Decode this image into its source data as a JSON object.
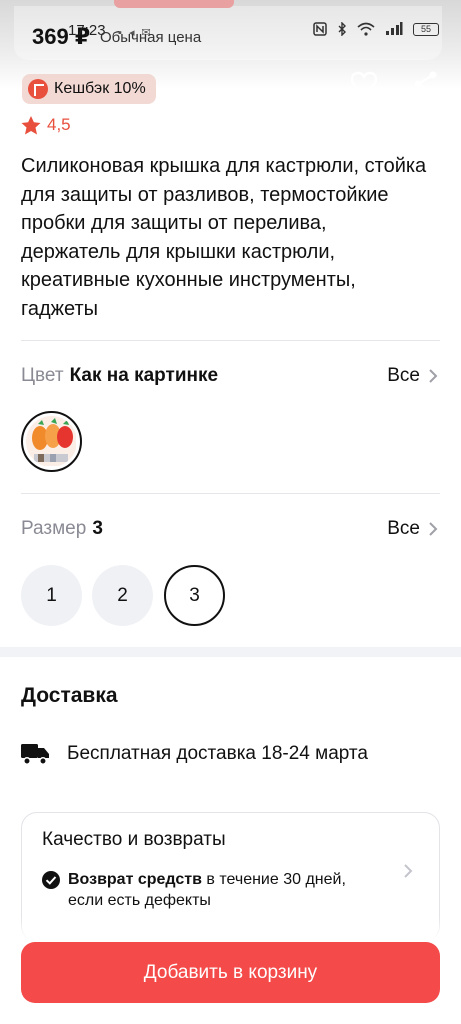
{
  "status_bar": {
    "time": "17:23",
    "battery": "55"
  },
  "header": {
    "price": "369 ₽",
    "price_note": "Обычная цена",
    "cashback": "Кешбэк 10%"
  },
  "product": {
    "rating": "4,5",
    "title": "Силиконовая крышка для кастрюли, стойка для защиты от разливов, термостойкие пробки для защиты от перелива, держатель для крышки кастрюли, креативные кухонные инструменты, гаджеты"
  },
  "color_option": {
    "label": "Цвет",
    "value": "Как на картинке",
    "all": "Все"
  },
  "size_option": {
    "label": "Размер",
    "value": "3",
    "all": "Все",
    "sizes": [
      "1",
      "2",
      "3"
    ],
    "selected": "3"
  },
  "delivery": {
    "title": "Доставка",
    "text": "Бесплатная доставка 18-24 марта"
  },
  "quality": {
    "title": "Качество и возвраты",
    "return_bold": "Возврат средств",
    "return_rest": " в течение 30 дней, если есть дефекты"
  },
  "cta": {
    "label": "Добавить в корзину"
  },
  "colors": {
    "accent": "#f44a4a",
    "rating": "#e84f3d",
    "muted": "#8a8a94"
  }
}
